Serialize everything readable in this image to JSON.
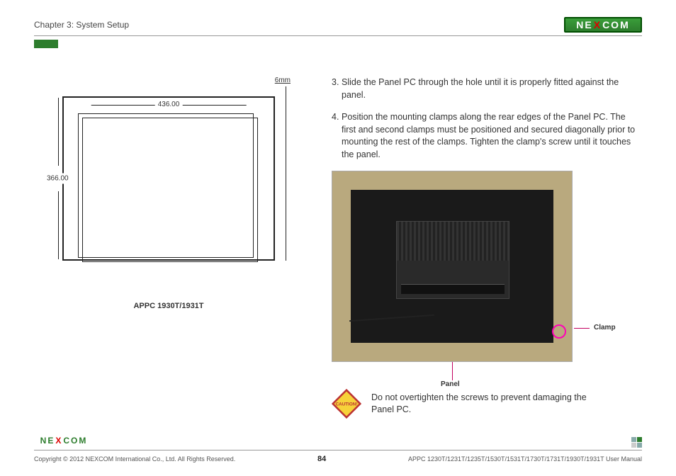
{
  "header": {
    "chapter": "Chapter 3: System Setup",
    "brand_left": "NE",
    "brand_x": "X",
    "brand_right": "COM"
  },
  "diagram": {
    "thickness": "6mm",
    "width_mm": "436.00",
    "height_mm": "366.00",
    "caption": "APPC 1930T/1931T"
  },
  "steps": {
    "s3_num": "3.",
    "s3_text": "Slide the Panel PC through the hole until it is properly fitted against the panel.",
    "s4_num": "4.",
    "s4_text": "Position the mounting clamps along the rear edges of the Panel PC. The first and second clamps must be positioned and secured diagonally prior to mounting the rest of the clamps. Tighten the clamp's screw until it touches the panel."
  },
  "photo_labels": {
    "clamp": "Clamp",
    "panel": "Panel"
  },
  "caution": {
    "icon_text": "CAUTION!",
    "text": "Do not overtighten the screws to prevent damaging the Panel PC."
  },
  "footer": {
    "copyright": "Copyright © 2012 NEXCOM International Co., Ltd. All Rights Reserved.",
    "page": "84",
    "doc": "APPC 1230T/1231T/1235T/1530T/1531T/1730T/1731T/1930T/1931T User Manual"
  }
}
